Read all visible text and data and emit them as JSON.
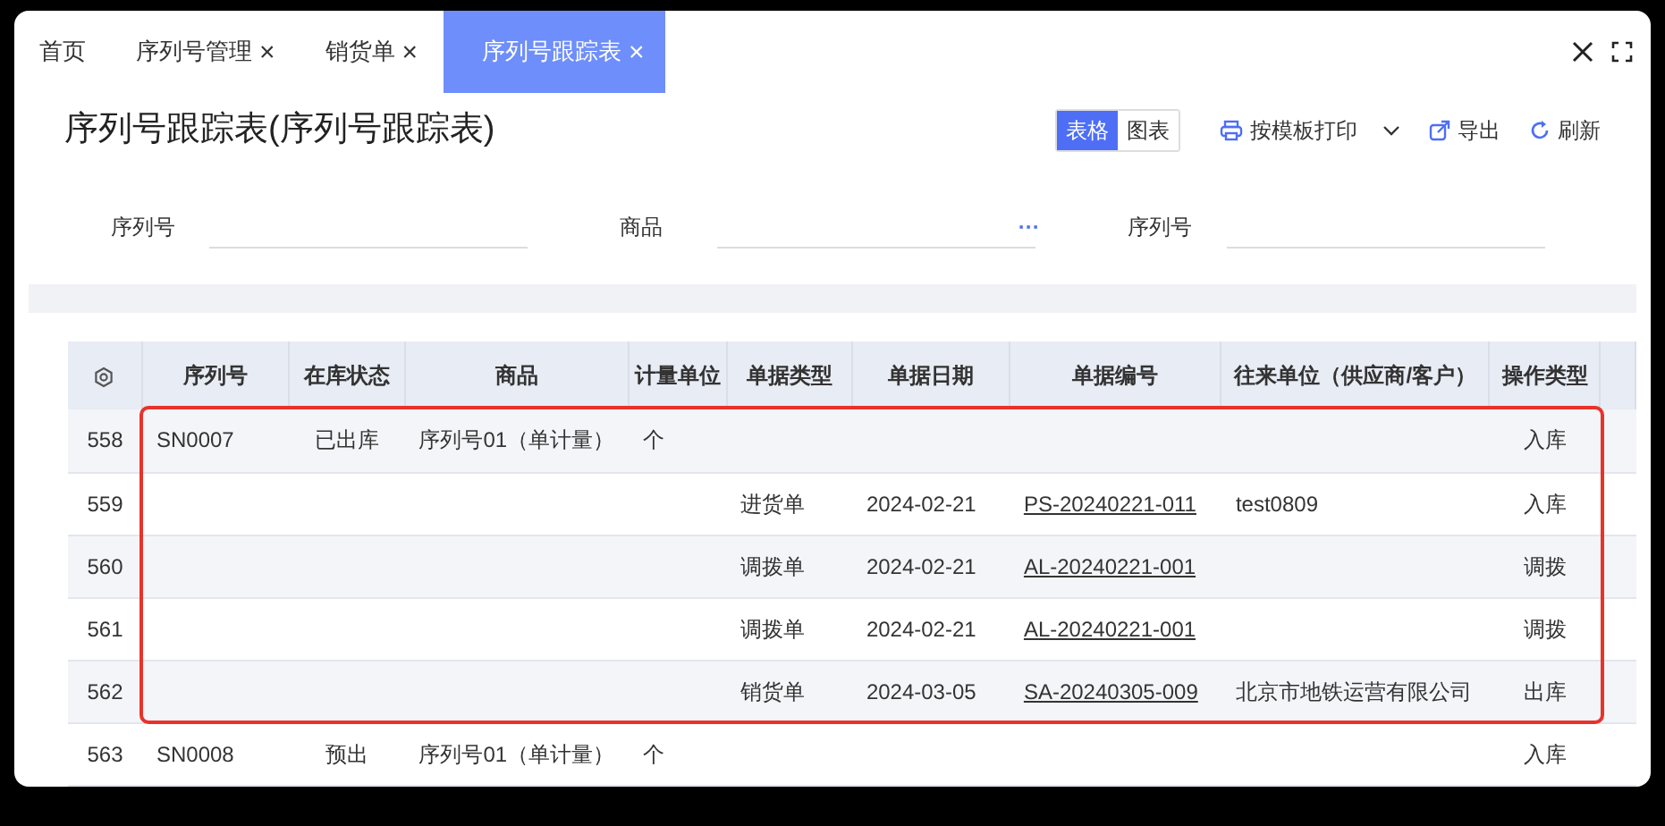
{
  "tabs": [
    {
      "label": "首页",
      "selected": false
    },
    {
      "label": "序列号管理",
      "close": "×",
      "selected": false
    },
    {
      "label": "销货单",
      "close": "×",
      "selected": false
    },
    {
      "label": "序列号跟踪表",
      "close": "×",
      "selected": true
    }
  ],
  "title": "序列号跟踪表(序列号跟踪表)",
  "view_toggle": [
    {
      "label": "表格",
      "selected": true
    },
    {
      "label": "图表",
      "selected": false
    }
  ],
  "actions": [
    {
      "label": "按模板打印",
      "kind": "print"
    },
    {
      "label": "导出",
      "kind": "export"
    },
    {
      "label": "刷新",
      "kind": "refresh"
    }
  ],
  "filters": [
    {
      "label": "序列号"
    },
    {
      "label": "商品",
      "more": "···"
    },
    {
      "label": "序列号"
    }
  ],
  "table": {
    "columns": [
      "序列号",
      "在库状态",
      "商品",
      "计量单位",
      "单据类型",
      "单据日期",
      "单据编号",
      "往来单位（供应商/客户）",
      "操作类型"
    ],
    "rows": [
      {
        "index": "558",
        "cells": [
          "SN0007",
          "已出库",
          "序列号01（单计量）",
          "个",
          "",
          "",
          "",
          "",
          "入库"
        ],
        "highlighted": true
      },
      {
        "index": "559",
        "cells": [
          "",
          "",
          "",
          "",
          "进货单",
          "2024-02-21",
          "PS-20240221-011",
          "test0809",
          "入库"
        ],
        "highlighted": true
      },
      {
        "index": "560",
        "cells": [
          "",
          "",
          "",
          "",
          "调拨单",
          "2024-02-21",
          "AL-20240221-001",
          "",
          "调拨"
        ],
        "highlighted": true
      },
      {
        "index": "561",
        "cells": [
          "",
          "",
          "",
          "",
          "调拨单",
          "2024-02-21",
          "AL-20240221-001",
          "",
          "调拨"
        ],
        "highlighted": true
      },
      {
        "index": "562",
        "cells": [
          "",
          "",
          "",
          "",
          "销货单",
          "2024-03-05",
          "SA-20240305-009",
          "北京市地铁运营有限公司",
          "出库"
        ],
        "highlighted": true
      },
      {
        "index": "563",
        "cells": [
          "SN0008",
          "预出",
          "序列号01（单计量）",
          "个",
          "",
          "",
          "",
          "",
          "入库"
        ],
        "highlighted": false
      }
    ]
  }
}
